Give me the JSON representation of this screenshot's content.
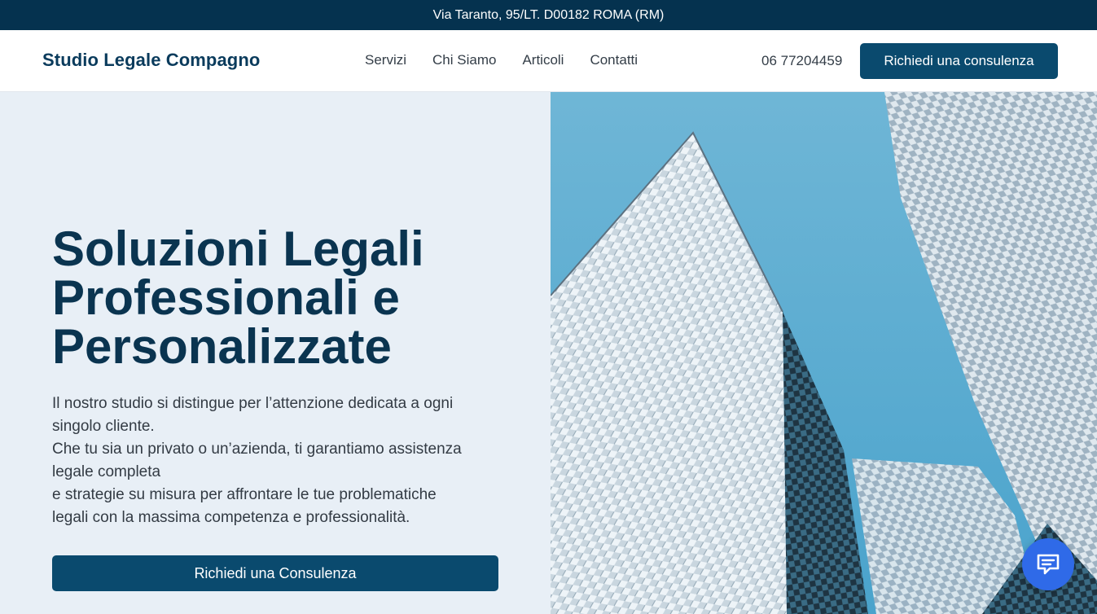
{
  "topbar": {
    "address": "Via Taranto, 95/LT. D00182 ROMA (RM)"
  },
  "header": {
    "brand": "Studio Legale Compagno",
    "nav": [
      "Servizi",
      "Chi Siamo",
      "Articoli",
      "Contatti"
    ],
    "phone": "06 77204459",
    "cta_label": "Richiedi una consulenza"
  },
  "hero": {
    "title_lines": [
      "Soluzioni Legali",
      "Professionali e",
      "Personalizzate"
    ],
    "description_lines": [
      "Il nostro studio si distingue per l’attenzione dedicata a ogni",
      "singolo cliente.",
      "Che tu sia un privato o un’azienda, ti garantiamo assistenza",
      "legale completa",
      "e strategie su misura per affrontare le tue problematiche",
      "legali con la massima competenza e professionalità."
    ],
    "cta_label": "Richiedi una Consulenza"
  },
  "colors": {
    "topbar_bg": "#05324f",
    "accent": "#0a4a6e",
    "hero_bg": "#e8eff6",
    "chat_bg": "#2f6ae8"
  },
  "icons": {
    "chat": "chat-bubble-icon"
  }
}
